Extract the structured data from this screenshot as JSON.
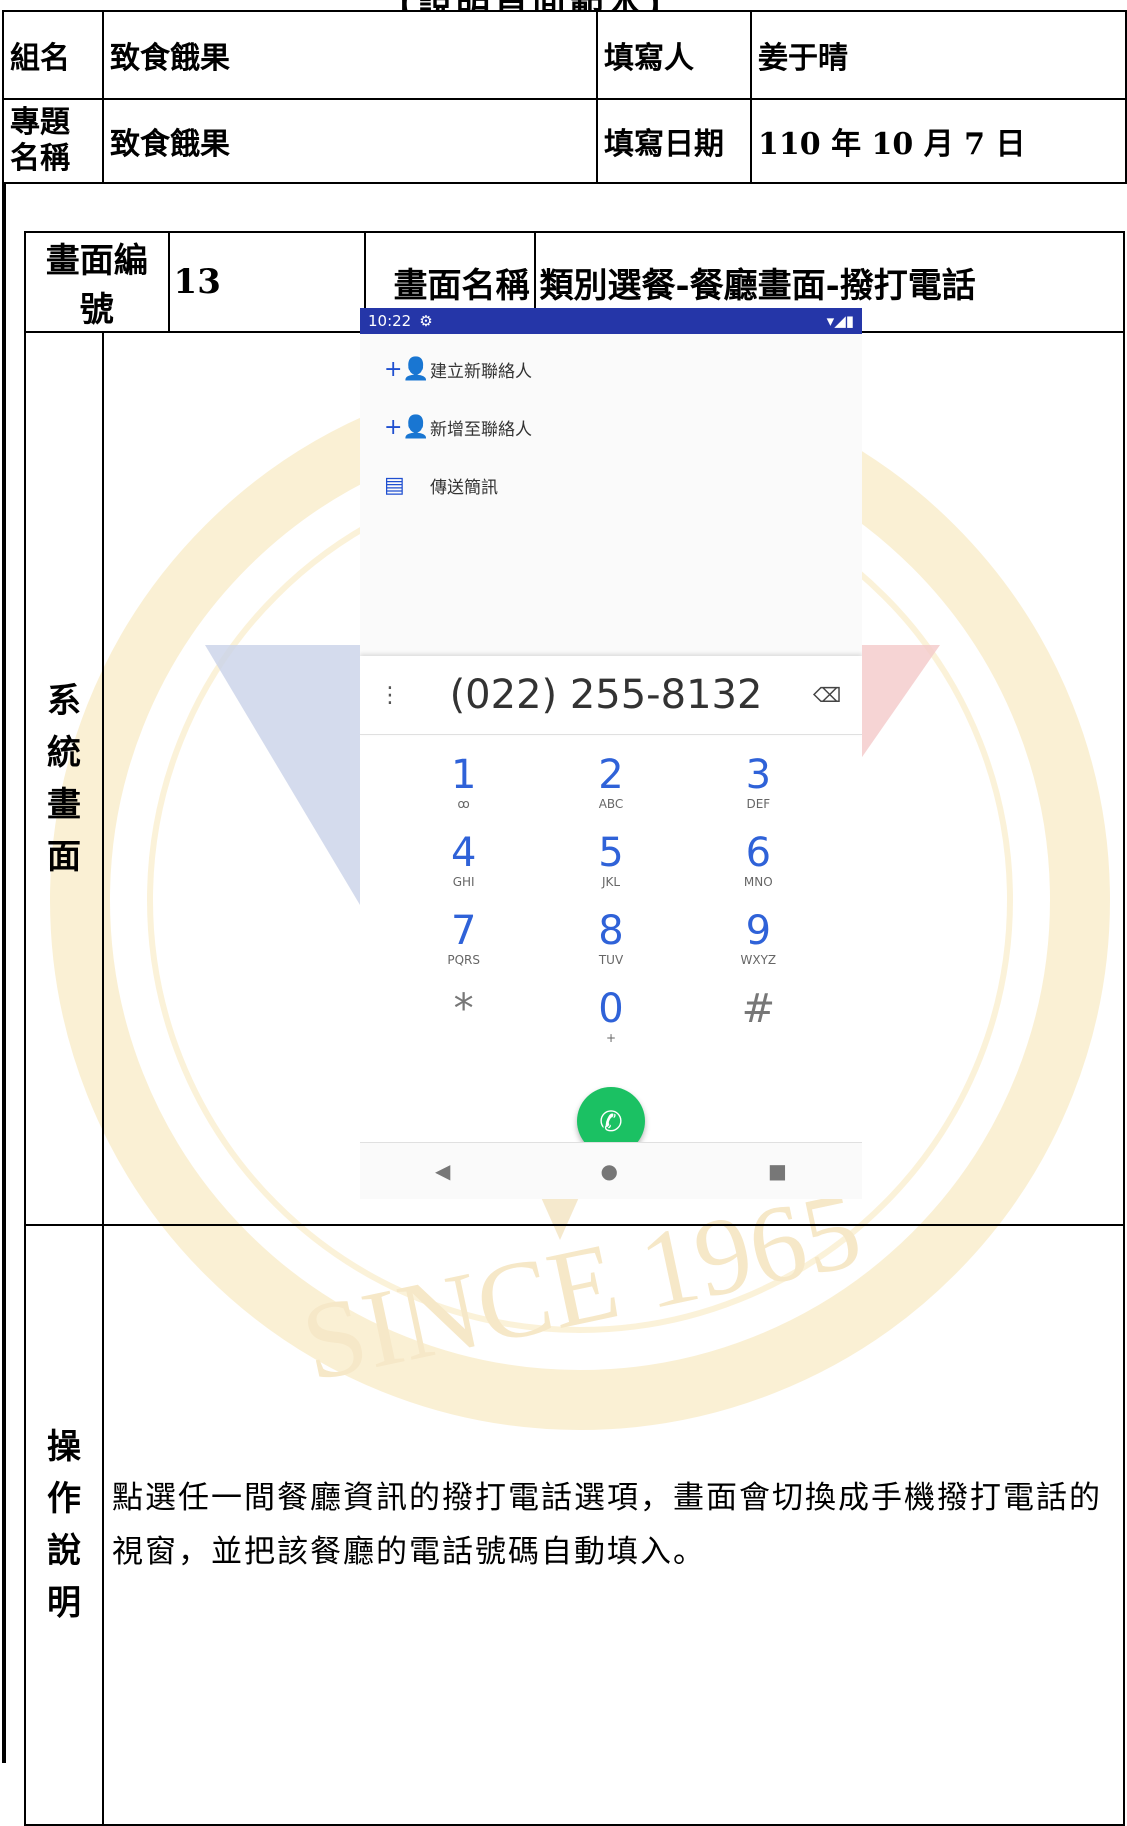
{
  "doc": {
    "title": "【說明頁面範本】",
    "header": {
      "group_label": "組名",
      "group_value": "致食餓果",
      "author_label": "填寫人",
      "author_value": "姜于晴",
      "topic_label": "專題名稱",
      "topic_value": "致食餓果",
      "date_label": "填寫日期",
      "date_value": "110 年 10 月 7 日"
    },
    "screen": {
      "id_label": "畫面編號",
      "id_value": "13",
      "name_label": "畫面名稱",
      "name_value": "類別選餐-餐廳畫面-撥打電話",
      "system_label": "系統畫面",
      "desc_label": "操作說明",
      "description": "點選任一間餐廳資訊的撥打電話選項，畫面會切換成手機撥打電話的視窗，並把該餐廳的電話號碼自動填入。"
    },
    "watermark_text": "SINCE 1965"
  },
  "phone": {
    "status_time": "10:22",
    "status_gear": "⚙",
    "status_icons": "▾◢▮",
    "menu": [
      {
        "icon": "+👤",
        "icon_name": "add-person-icon",
        "label": "建立新聯絡人"
      },
      {
        "icon": "+👤",
        "icon_name": "add-person-icon",
        "label": "新增至聯絡人"
      },
      {
        "icon": "▤",
        "icon_name": "message-icon",
        "label": "傳送簡訊"
      }
    ],
    "dots": "⋮",
    "number": "(022) 255-8132",
    "backspace": "⌫",
    "keys": [
      {
        "digit": "1",
        "letters": "ꝏ"
      },
      {
        "digit": "2",
        "letters": "ABC"
      },
      {
        "digit": "3",
        "letters": "DEF"
      },
      {
        "digit": "4",
        "letters": "GHI"
      },
      {
        "digit": "5",
        "letters": "JKL"
      },
      {
        "digit": "6",
        "letters": "MNO"
      },
      {
        "digit": "7",
        "letters": "PQRS"
      },
      {
        "digit": "8",
        "letters": "TUV"
      },
      {
        "digit": "9",
        "letters": "WXYZ"
      },
      {
        "digit": "*",
        "letters": ""
      },
      {
        "digit": "0",
        "letters": "+"
      },
      {
        "digit": "#",
        "letters": ""
      }
    ],
    "call_icon": "✆",
    "nav": {
      "back": "◀",
      "home": "●",
      "recent": "■"
    },
    "colors": {
      "status_bar": "#2536a8",
      "accent": "#2f62d8",
      "call": "#1bc163"
    }
  }
}
